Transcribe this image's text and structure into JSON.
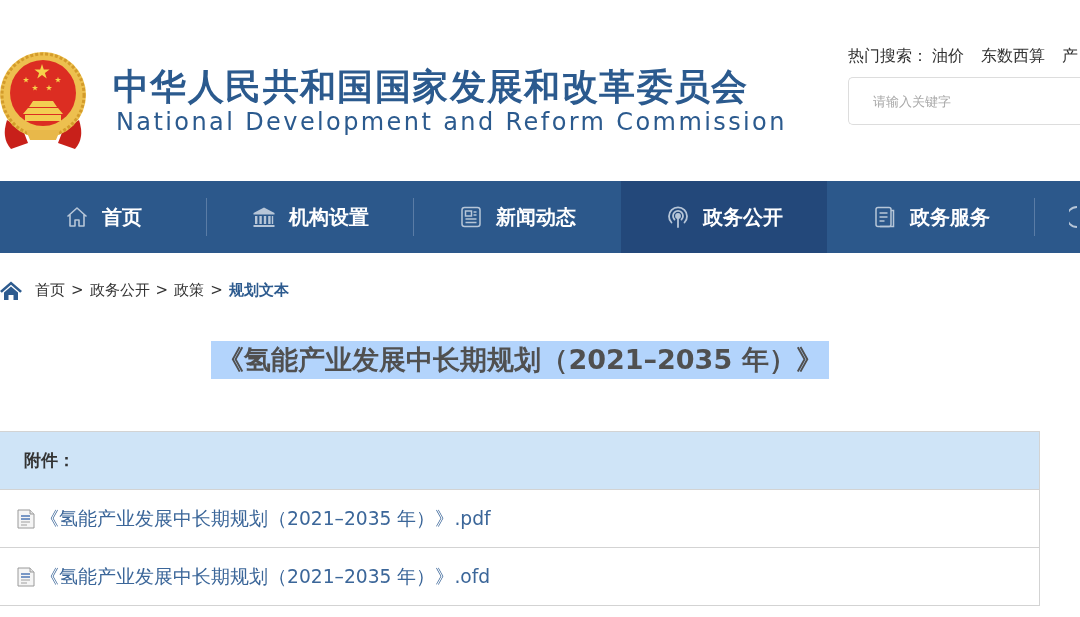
{
  "site_header": {
    "title": "中华人民共和国国家发展和改革委员会",
    "subtitle": "National Development and Reform Commission",
    "hot_search": {
      "label": "热门搜索：",
      "terms": [
        "油价",
        "东数西算",
        "产"
      ]
    },
    "search": {
      "placeholder": "请输入关键字"
    }
  },
  "nav": {
    "items": [
      {
        "label": "首页",
        "selected": false
      },
      {
        "label": "机构设置",
        "selected": false
      },
      {
        "label": "新闻动态",
        "selected": false
      },
      {
        "label": "政务公开",
        "selected": true
      },
      {
        "label": "政务服务",
        "selected": false
      }
    ]
  },
  "breadcrumb": {
    "separator": ">",
    "items": [
      {
        "label": "首页",
        "current": false
      },
      {
        "label": "政务公开",
        "current": false
      },
      {
        "label": "政策",
        "current": false
      },
      {
        "label": "规划文本",
        "current": true
      }
    ]
  },
  "article": {
    "title": "《氢能产业发展中长期规划（2021–2035 年）》",
    "highlighted": true
  },
  "attachments": {
    "heading": "附件：",
    "files": [
      {
        "name": "《氢能产业发展中长期规划（2021–2035 年）》.pdf"
      },
      {
        "name": "《氢能产业发展中长期规划（2021–2035 年）》.ofd"
      }
    ]
  }
}
